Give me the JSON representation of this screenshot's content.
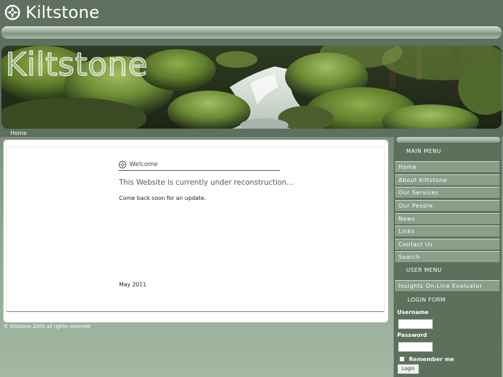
{
  "site": {
    "logo_text": "Kiltstone",
    "logo_icon": "kiltstone-emblem-icon",
    "banner_title": "Kiltstone"
  },
  "breadcrumb": {
    "home": "Home"
  },
  "article": {
    "title": "Welcome",
    "title_icon": "kiltstone-emblem-icon",
    "headline": "This Website is currently under reconstruction...",
    "body": "Come back soon for an update.",
    "date": "May 2011"
  },
  "footer": {
    "copyright": "© Kiltstone 2005 all rights reserved"
  },
  "sidebar": {
    "main_menu_title": "MAIN MENU",
    "main_menu": [
      {
        "label": "Home"
      },
      {
        "label": "About Kiltstone"
      },
      {
        "label": "Our Services"
      },
      {
        "label": "Our People"
      },
      {
        "label": "News"
      },
      {
        "label": "Links"
      },
      {
        "label": "Contact Us"
      },
      {
        "label": "Search"
      }
    ],
    "user_menu_title": "USER MENU",
    "user_menu": [
      {
        "label": "Insights On-Line Evaluator"
      }
    ],
    "login_form": {
      "title": "LOGIN FORM",
      "username_label": "Username",
      "username_value": "",
      "password_label": "Password",
      "password_value": "",
      "remember_label": "Remember me",
      "remember_checked": false,
      "button_label": "Login"
    }
  },
  "colors": {
    "page_bg": "#5e7060",
    "sidebar_bg": "#5c705c",
    "menu_item_bg": "#8a9f8a",
    "panel_bg": "#ffffff"
  }
}
